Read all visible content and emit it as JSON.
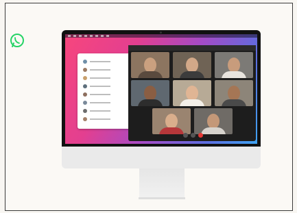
{
  "scene": {
    "description_label": "",
    "logo_icon": "whatsapp-icon",
    "colors": {
      "brand": "#25D366",
      "frame_border": "#3a3a3a",
      "wallpaper_start": "#f7467d",
      "wallpaper_end": "#3fa3f2",
      "call_window_bg": "#1d1d1d"
    }
  },
  "call": {
    "participant_count": 8,
    "controls": [
      "mic",
      "video",
      "end-call"
    ]
  },
  "chats": {
    "row_count": 8
  }
}
